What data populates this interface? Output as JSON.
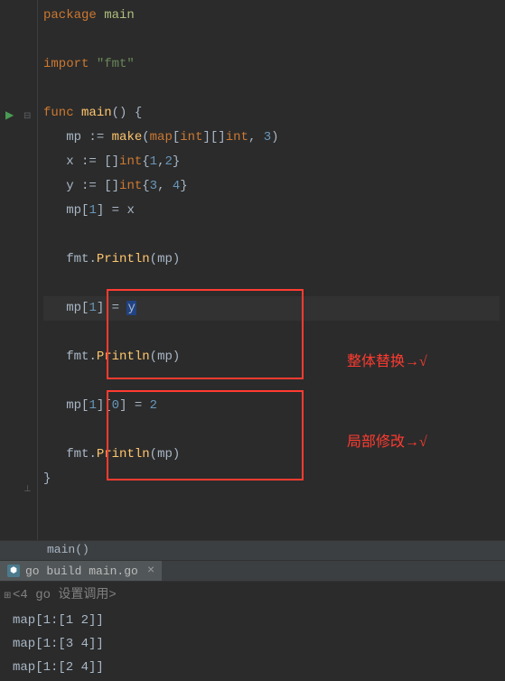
{
  "code": {
    "line1_kw_package": "package",
    "line1_pkg": "main",
    "line3_kw_import": "import",
    "line3_str": "\"fmt\"",
    "line5_kw_func": "func",
    "line5_fn": "main",
    "line5_rest": "() {",
    "line6_ident": "mp",
    "line6_op": " := ",
    "line6_make": "make",
    "line6_p1": "(",
    "line6_map": "map",
    "line6_b1": "[",
    "line6_int1": "int",
    "line6_b2": "][]",
    "line6_int2": "int",
    "line6_comma": ", ",
    "line6_num": "3",
    "line6_p2": ")",
    "line7_x": "x",
    "line7_op": " := []",
    "line7_int": "int",
    "line7_b1": "{",
    "line7_n1": "1",
    "line7_c": ",",
    "line7_n2": "2",
    "line7_b2": "}",
    "line8_y": "y",
    "line8_op": " := []",
    "line8_int": "int",
    "line8_b1": "{",
    "line8_n1": "3",
    "line8_c": ", ",
    "line8_n2": "4",
    "line8_b2": "}",
    "line9_mp": "mp",
    "line9_b1": "[",
    "line9_n": "1",
    "line9_b2": "] = ",
    "line9_x": "x",
    "line11_fmt": "fmt",
    "line11_dot": ".",
    "line11_println": "Println",
    "line11_p1": "(",
    "line11_mp": "mp",
    "line11_p2": ")",
    "line13_mp": "mp",
    "line13_b1": "[",
    "line13_n": "1",
    "line13_rest": "] = ",
    "line13_y": "y",
    "line15_fmt": "fmt",
    "line15_dot": ".",
    "line15_println": "Println",
    "line15_p1": "(",
    "line15_mp": "mp",
    "line15_p2": ")",
    "line17_mp": "mp",
    "line17_b1": "[",
    "line17_n1": "1",
    "line17_b2": "][",
    "line17_n2": "0",
    "line17_b3": "] = ",
    "line17_n3": "2",
    "line19_fmt": "fmt",
    "line19_dot": ".",
    "line19_println": "Println",
    "line19_p1": "(",
    "line19_mp": "mp",
    "line19_p2": ")",
    "line20": "}"
  },
  "annotations": {
    "anno1": "整体替换→√",
    "anno2": "局部修改→√"
  },
  "breadcrumb": "main()",
  "tab": {
    "label": "go build main.go"
  },
  "console": {
    "header_prefix": "<4 go ",
    "header_suffix": "设置调用>",
    "out1": "map[1:[1 2]]",
    "out2": "map[1:[3 4]]",
    "out3": "map[1:[2 4]]"
  }
}
